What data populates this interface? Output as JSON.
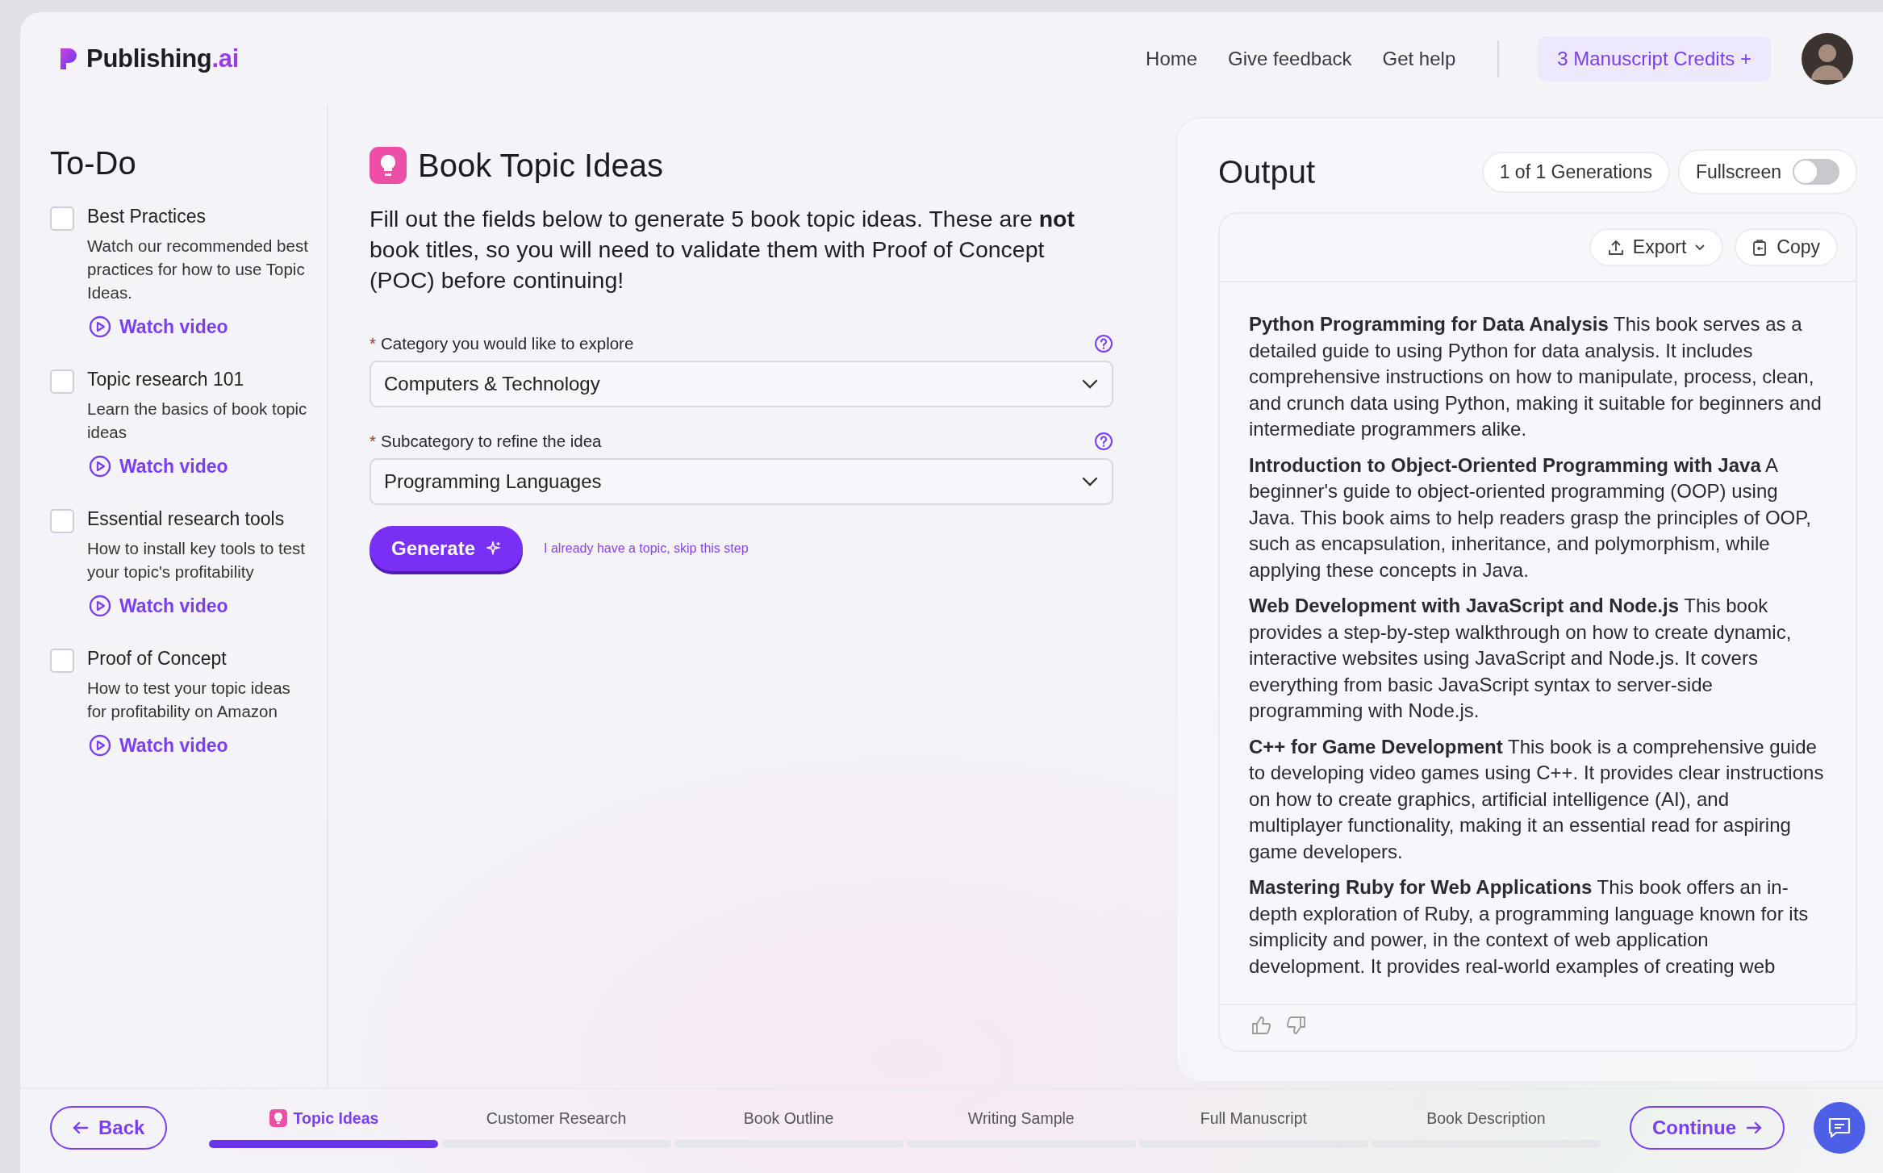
{
  "header": {
    "logo": {
      "name": "Publishing",
      "suffix": ".ai"
    },
    "nav": [
      "Home",
      "Give feedback",
      "Get help"
    ],
    "credits": "3 Manuscript Credits +"
  },
  "todo": {
    "title": "To-Do",
    "items": [
      {
        "title": "Best Practices",
        "description": "Watch our recommended best practices for how to use Topic Ideas.",
        "link": "Watch video",
        "checked": false
      },
      {
        "title": "Topic research 101",
        "description": "Learn the basics of book topic ideas",
        "link": "Watch video",
        "checked": false
      },
      {
        "title": "Essential research tools",
        "description": "How to install key tools to test your topic's profitability",
        "link": "Watch video",
        "checked": false
      },
      {
        "title": "Proof of Concept",
        "description": "How to test your topic ideas for profitability on Amazon",
        "link": "Watch video",
        "checked": false
      }
    ]
  },
  "form": {
    "title": "Book Topic Ideas",
    "description": "Fill out the fields below to generate 5 book topic ideas. These are **not** book titles, so you will need to validate them with Proof of Concept (POC) before continuing!",
    "fields": [
      {
        "required_mark": "*",
        "label": "Category you would like to explore",
        "value": "Computers & Technology"
      },
      {
        "required_mark": "*",
        "label": "Subcategory to refine the idea",
        "value": "Programming Languages"
      }
    ],
    "generate": "Generate",
    "skip_link": "I already have a topic, skip this step"
  },
  "output": {
    "title": "Output",
    "generations": "1 of 1 Generations",
    "fullscreen": {
      "label": "Fullscreen",
      "on": false
    },
    "export": "Export",
    "copy": "Copy",
    "items": [
      "**Python Programming for Data Analysis** This book serves as a detailed guide to using Python for data analysis. It includes comprehensive instructions on how to manipulate, process, clean, and crunch data using Python, making it suitable for beginners and intermediate programmers alike.",
      "**Introduction to Object-Oriented Programming with Java** A beginner's guide to object-oriented programming (OOP) using Java. This book aims to help readers grasp the principles of OOP, such as encapsulation, inheritance, and polymorphism, while applying these concepts in Java.",
      "**Web Development with JavaScript and Node.js** This book provides a step-by-step walkthrough on how to create dynamic, interactive websites using JavaScript and Node.js. It covers everything from basic JavaScript syntax to server-side programming with Node.js.",
      "**C++ for Game Development** This book is a comprehensive guide to developing video games using C++. It provides clear instructions on how to create graphics, artificial intelligence (AI), and multiplayer functionality, making it an essential read for aspiring game developers.",
      "**Mastering Ruby for Web Applications** This book offers an in-depth exploration of Ruby, a programming language known for its simplicity and power, in the context of web application development. It provides real-world examples of creating web"
    ]
  },
  "footer": {
    "back": "Back",
    "continue": "Continue",
    "steps": [
      {
        "label": "Topic Ideas",
        "selected": true
      },
      {
        "label": "Customer Research",
        "selected": false
      },
      {
        "label": "Book Outline",
        "selected": false
      },
      {
        "label": "Writing Sample",
        "selected": false
      },
      {
        "label": "Full Manuscript",
        "selected": false
      },
      {
        "label": "Book Description",
        "selected": false
      }
    ]
  }
}
